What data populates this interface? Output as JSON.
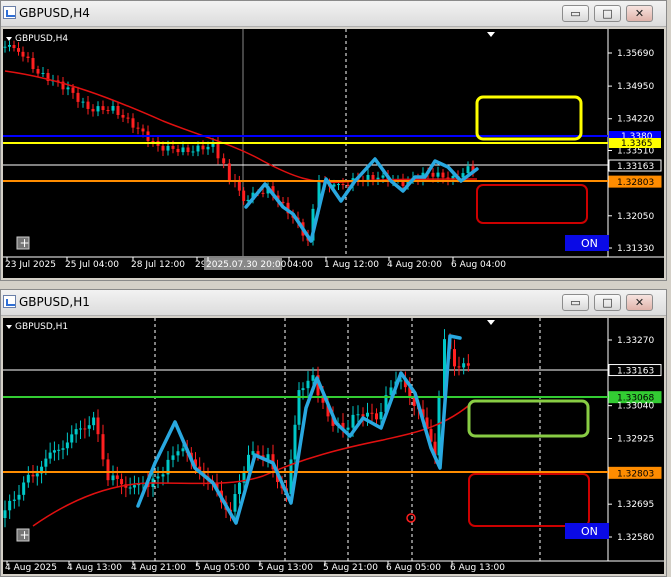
{
  "top_window": {
    "title": "GBPUSD,H4",
    "symbol_label": "GBPUSD,H4",
    "price_labels": [
      {
        "text": "1.35690",
        "value": 1.3569,
        "kind": "scale"
      },
      {
        "text": "1.34950",
        "value": 1.3495,
        "kind": "scale"
      },
      {
        "text": "1.34220",
        "value": 1.3422,
        "kind": "scale"
      },
      {
        "text": "1.33510",
        "value": 1.3351,
        "kind": "scale"
      },
      {
        "text": "1.33163",
        "value": 1.33163,
        "kind": "current"
      },
      {
        "text": "1.32803",
        "value": 1.32803,
        "kind": "orange"
      },
      {
        "text": "1.32050",
        "value": 1.3205,
        "kind": "scale"
      },
      {
        "text": "1.31330",
        "value": 1.3133,
        "kind": "scale"
      }
    ],
    "blue_badge_text": "1.3380",
    "yellow_badge_text": "1.3365",
    "time_labels": [
      "23 Jul 2025",
      "25 Jul 04:00",
      "28 Jul 12:00",
      "29",
      "2025.07.30 20:00",
      "04:00",
      "1 Aug 12:00",
      "4 Aug 20:00",
      "6 Aug 04:00"
    ],
    "on_button": "ON",
    "colors": {
      "bull": "#00c8c8",
      "bear": "#ff2020",
      "ma": "#e01010",
      "blue_line": "#0000ff",
      "yellow_line": "#ffff00",
      "orange_line": "#ff8c00",
      "zigzag": "#29a8e0",
      "yellow_box": "#ffff00",
      "red_box": "#cc0000"
    }
  },
  "bottom_window": {
    "title": "GBPUSD,H1",
    "symbol_label": "GBPUSD,H1",
    "price_labels": [
      {
        "text": "1.33270",
        "value": 1.3327,
        "kind": "scale"
      },
      {
        "text": "1.33163",
        "value": 1.33163,
        "kind": "current"
      },
      {
        "text": "1.33068",
        "value": 1.33068,
        "kind": "green"
      },
      {
        "text": "1.33040",
        "value": 1.3304,
        "kind": "scale"
      },
      {
        "text": "1.32925",
        "value": 1.32925,
        "kind": "scale"
      },
      {
        "text": "1.32803",
        "value": 1.32803,
        "kind": "orange"
      },
      {
        "text": "1.32695",
        "value": 1.32695,
        "kind": "scale"
      },
      {
        "text": "1.32580",
        "value": 1.3258,
        "kind": "scale"
      }
    ],
    "time_labels": [
      "4 Aug 2025",
      "4 Aug 13:00",
      "4 Aug 21:00",
      "5 Aug 05:00",
      "5 Aug 13:00",
      "5 Aug 21:00",
      "6 Aug 05:00",
      "6 Aug 13:00"
    ],
    "on_button": "ON",
    "colors": {
      "green_line": "#33cc33",
      "green_box": "#88cc44"
    }
  },
  "window_buttons": {
    "minimize": "▭",
    "maximize": "□",
    "close": "✕"
  }
}
